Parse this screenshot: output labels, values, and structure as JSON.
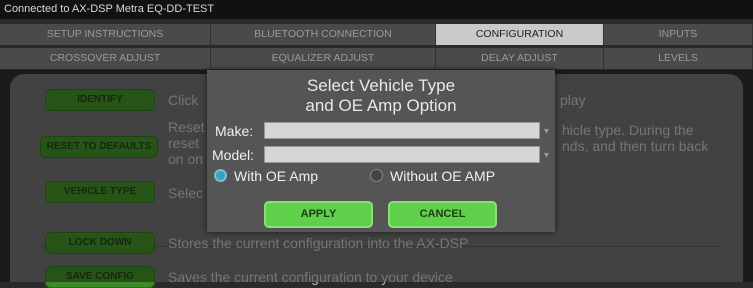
{
  "status_bar": {
    "text": "Connected to AX-DSP Metra EQ-DD-TEST"
  },
  "tabs_row1": [
    {
      "label": "SETUP INSTRUCTIONS"
    },
    {
      "label": "BLUETOOTH CONNECTION"
    },
    {
      "label": "CONFIGURATION"
    },
    {
      "label": "INPUTS"
    }
  ],
  "tabs_row2": [
    {
      "label": "CROSSOVER ADJUST"
    },
    {
      "label": "EQUALIZER ADJUST"
    },
    {
      "label": "DELAY ADJUST"
    },
    {
      "label": "LEVELS"
    }
  ],
  "actions": {
    "identify": {
      "button": "IDENTIFY",
      "desc": "Click",
      "desc_tail": "play"
    },
    "reset": {
      "button": "RESET TO DEFAULTS",
      "desc_line1": "Reset",
      "desc_line2": "reset",
      "desc_line3": "on on",
      "desc_tail1": "hicle type. During the",
      "desc_tail2": "nds, and then turn back"
    },
    "vehicle_type": {
      "button": "VEHICLE TYPE",
      "desc": "Selec"
    },
    "lock_down": {
      "button": "LOCK DOWN",
      "desc": "Stores the current configuration into the AX-DSP"
    },
    "save_config": {
      "button": "SAVE CONFIG",
      "desc": "Saves the current configuration to your device"
    }
  },
  "dialog": {
    "title_line1": "Select Vehicle Type",
    "title_line2": "and OE Amp Option",
    "make_label": "Make:",
    "make_value": "",
    "model_label": "Model:",
    "model_value": "",
    "radio_with": "With OE Amp",
    "radio_without": "Without OE AMP",
    "selected_option": "With OE Amp",
    "apply_label": "APPLY",
    "cancel_label": "CANCEL"
  },
  "colors": {
    "accent_green": "#3f8a28",
    "dialog_button_green": "#5fd04a",
    "radio_selected": "#3fa0b8",
    "active_tab": "#c9c9c9"
  }
}
